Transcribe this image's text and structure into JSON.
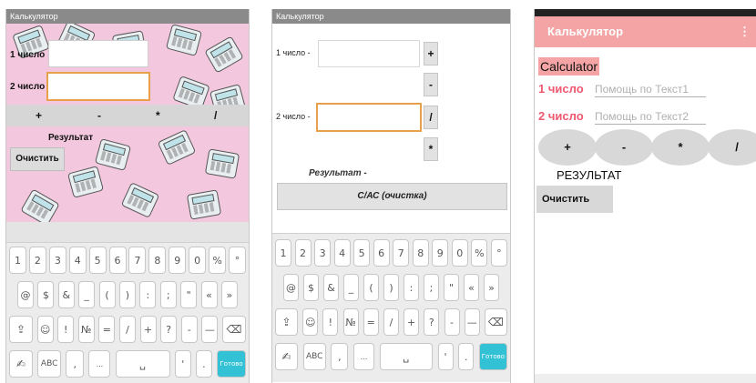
{
  "screen1": {
    "title": "Калькулятор",
    "label1": "1 число",
    "label2": "2 число",
    "ops": [
      "+",
      "-",
      "*",
      "/"
    ],
    "result_label": "Результат",
    "clear_label": "Очистить"
  },
  "screen2": {
    "title": "Калькулятор",
    "label1": "1 число -",
    "label2": "2 число -",
    "ops": [
      "+",
      "-",
      "/",
      "*"
    ],
    "result_label": "Результат -",
    "clear_label": "С/АС (очистка)"
  },
  "screen3": {
    "title": "Калькулятор",
    "menu_icon": "⋮",
    "heading": "Calculator",
    "label1": "1 число",
    "label2": "2 число",
    "hint1": "Помощь по Текст1",
    "hint2": "Помощь по Текст2",
    "ops": [
      "+",
      "-",
      "*",
      "/"
    ],
    "result_label": "РЕЗУЛЬТАТ",
    "clear_label": "Очистить"
  },
  "keyboard": {
    "row1": [
      "1",
      "2",
      "3",
      "4",
      "5",
      "6",
      "7",
      "8",
      "9",
      "0",
      "%",
      "°"
    ],
    "row2": [
      "@",
      "$",
      "&",
      "_",
      "(",
      ")",
      ":",
      ";",
      "\"",
      "«",
      "»"
    ],
    "row3": [
      "⇪",
      "☺",
      "!",
      "№",
      "=",
      "/",
      "+",
      "?",
      "-",
      "—",
      "⌫"
    ],
    "row4": [
      "✍",
      "ABC",
      ",",
      "...",
      "␣",
      "'",
      ".",
      "Готово"
    ]
  },
  "colors": {
    "accent_pink": "#f4a4a4",
    "label_pink": "#f05870",
    "focus_orange": "#e8a04a",
    "done_key": "#33c1d6",
    "pattern_bg": "#f3c8de"
  }
}
